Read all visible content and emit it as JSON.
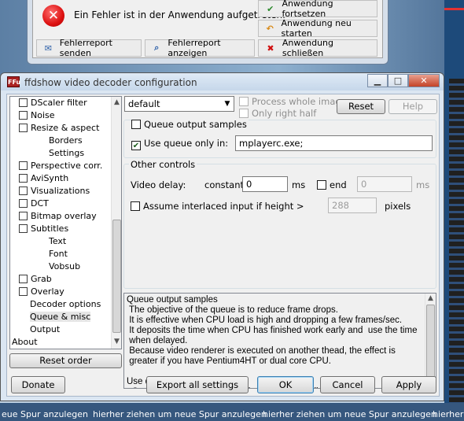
{
  "background": {
    "bottom_strip": [
      "eue Spur anzulegen",
      "hierher ziehen um neue Spur anzulegen",
      "hierher ziehen um neue Spur anzulegen",
      "hierher"
    ]
  },
  "error_dialog": {
    "message": "Ein Fehler ist in der Anwendung aufgetreten.",
    "buttons": {
      "continue": "Anwendung fortsetzen",
      "restart": "Anwendung neu starten",
      "send_report": "Fehlerreport senden",
      "show_report": "Fehlerreport anzeigen",
      "close_app": "Anwendung schließen"
    }
  },
  "window": {
    "title": "ffdshow video decoder configuration",
    "icon_text": "FFu"
  },
  "tree": {
    "items": [
      {
        "label": "DScaler filter",
        "checkbox": true,
        "indent": 0
      },
      {
        "label": "Noise",
        "checkbox": true,
        "indent": 0
      },
      {
        "label": "Resize & aspect",
        "checkbox": true,
        "indent": 0
      },
      {
        "label": "Borders",
        "checkbox": false,
        "indent": 2
      },
      {
        "label": "Settings",
        "checkbox": false,
        "indent": 2
      },
      {
        "label": "Perspective corr.",
        "checkbox": true,
        "indent": 0
      },
      {
        "label": "AviSynth",
        "checkbox": true,
        "indent": 0
      },
      {
        "label": "Visualizations",
        "checkbox": true,
        "indent": 0
      },
      {
        "label": "DCT",
        "checkbox": true,
        "indent": 0
      },
      {
        "label": "Bitmap overlay",
        "checkbox": true,
        "indent": 0
      },
      {
        "label": "Subtitles",
        "checkbox": true,
        "indent": 0
      },
      {
        "label": "Text",
        "checkbox": false,
        "indent": 2
      },
      {
        "label": "Font",
        "checkbox": false,
        "indent": 2
      },
      {
        "label": "Vobsub",
        "checkbox": false,
        "indent": 2
      },
      {
        "label": "Grab",
        "checkbox": true,
        "indent": 0
      },
      {
        "label": "Overlay",
        "checkbox": true,
        "indent": 0
      },
      {
        "label": "Decoder options",
        "checkbox": false,
        "indent": 1
      },
      {
        "label": "Queue & misc",
        "checkbox": false,
        "indent": 1,
        "selected": true
      },
      {
        "label": "Output",
        "checkbox": false,
        "indent": 1
      },
      {
        "label": "About",
        "checkbox": false,
        "indent": -1
      }
    ]
  },
  "preset": {
    "value": "default",
    "process_whole_image": "Process whole image",
    "only_right_half": "Only right half",
    "reset": "Reset",
    "help": "Help"
  },
  "queue": {
    "queue_output_samples": "Queue output samples",
    "use_queue_only_in": "Use queue only in:",
    "use_queue_value": "mplayerc.exe;"
  },
  "other_controls": {
    "title": "Other controls",
    "video_delay_label": "Video delay:",
    "constant_label": "constant",
    "delay_value": "0",
    "ms1": "ms",
    "end_label": "end",
    "end_value": "0",
    "ms2": "ms",
    "interlaced_label": "Assume interlaced input if height >",
    "height_value": "288",
    "pixels": "pixels"
  },
  "help_text": {
    "text": "Queue output samples\n The objective of the queue is to reduce frame drops.\n It is effective when CPU load is high and dropping a few frames/sec.\n It deposits the time when CPU has finished work early and  use the time\n when delayed.\n Because video renderer is executed on another thead, the effect is\n greater if you have Pentium4HT or dual core CPU.\n\nUse queue only in:\n  Queue is disabled by default because of stability problem.\n  If you dare try it, uncheck or add the execute file name of the video\n  applications, separated by semicolons.\n\nOther controls"
  },
  "buttons": {
    "reset_order": "Reset order",
    "donate": "Donate",
    "export_all": "Export all settings",
    "ok": "OK",
    "cancel": "Cancel",
    "apply": "Apply"
  }
}
